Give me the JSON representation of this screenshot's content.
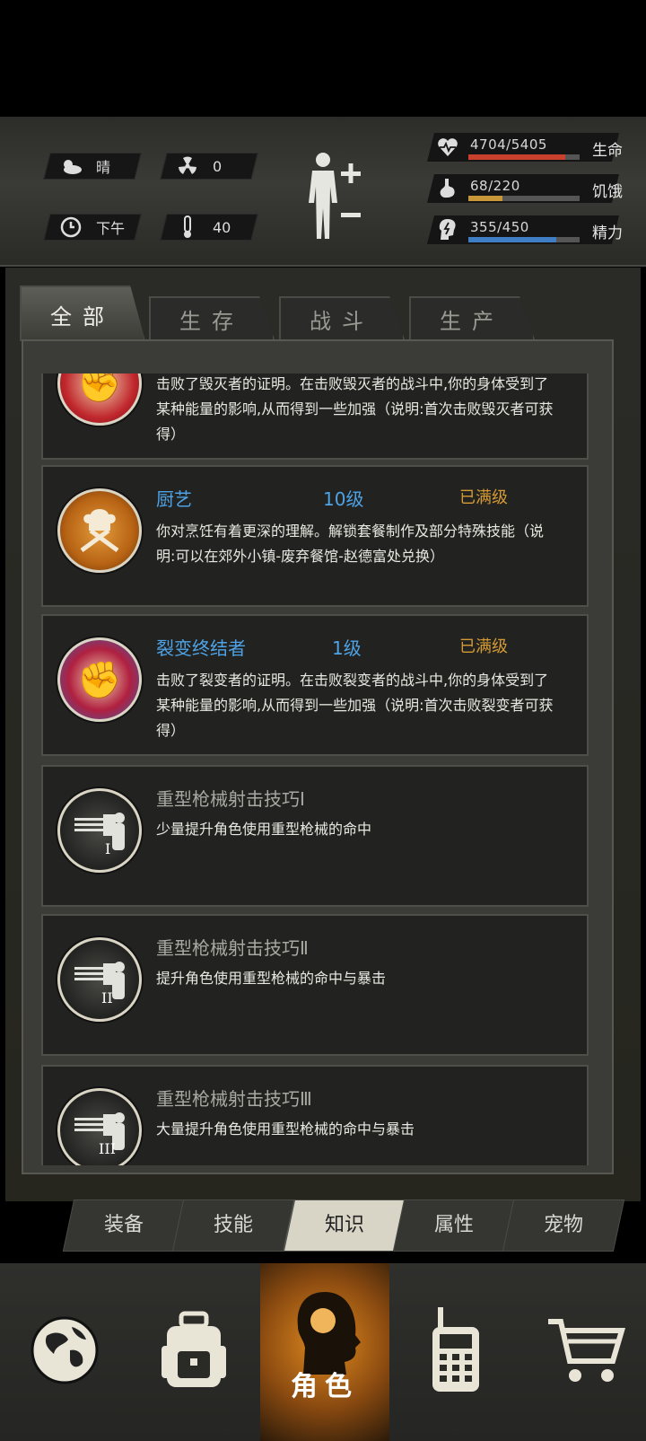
{
  "status": {
    "weather": "晴",
    "radiation": "0",
    "time": "下午",
    "temperature": "40",
    "stats": [
      {
        "value": "4704/5405",
        "label": "生命",
        "fraction": 0.87,
        "color": "#c9402d"
      },
      {
        "value": "68/220",
        "label": "饥饿",
        "fraction": 0.31,
        "color": "#c8973a"
      },
      {
        "value": "355/450",
        "label": "精力",
        "fraction": 0.79,
        "color": "#3f7ec4"
      }
    ]
  },
  "tabs": [
    {
      "label": "全部",
      "active": true
    },
    {
      "label": "生存",
      "active": false
    },
    {
      "label": "战斗",
      "active": false
    },
    {
      "label": "生产",
      "active": false
    }
  ],
  "cards": [
    {
      "title": "",
      "level": "",
      "max": "",
      "desc": "击败了毁灭者的证明。在击败毁灭者的战斗中,你的身体受到了某种能量的影响,从而得到一些加强（说明:首次击败毁灭者可获得）",
      "icon": "fist-icon"
    },
    {
      "title": "厨艺",
      "level": "10级",
      "max": "已满级",
      "desc": "你对烹饪有着更深的理解。解锁套餐制作及部分特殊技能（说明:可以在郊外小镇-废弃餐馆-赵德富处兑换）",
      "icon": "chef-icon"
    },
    {
      "title": "裂变终结者",
      "level": "1级",
      "max": "已满级",
      "desc": "击败了裂变者的证明。在击败裂变者的战斗中,你的身体受到了某种能量的影响,从而得到一些加强（说明:首次击败裂变者可获得）",
      "icon": "fist-icon"
    },
    {
      "title": "重型枪械射击技巧Ⅰ",
      "level": "",
      "max": "",
      "desc": "少量提升角色使用重型枪械的命中",
      "icon": "gatling-icon"
    },
    {
      "title": "重型枪械射击技巧Ⅱ",
      "level": "",
      "max": "",
      "desc": "提升角色使用重型枪械的命中与暴击",
      "icon": "gatling-icon"
    },
    {
      "title": "重型枪械射击技巧Ⅲ",
      "level": "",
      "max": "",
      "desc": "大量提升角色使用重型枪械的命中与暴击",
      "icon": "gatling-icon"
    }
  ],
  "subtabs": [
    {
      "label": "装备",
      "active": false
    },
    {
      "label": "技能",
      "active": false
    },
    {
      "label": "知识",
      "active": true
    },
    {
      "label": "属性",
      "active": false
    },
    {
      "label": "宠物",
      "active": false
    }
  ],
  "nav": {
    "active_label": "角色",
    "items": [
      "globe-icon",
      "backpack-icon",
      "character-icon",
      "radio-icon",
      "cart-icon"
    ]
  }
}
